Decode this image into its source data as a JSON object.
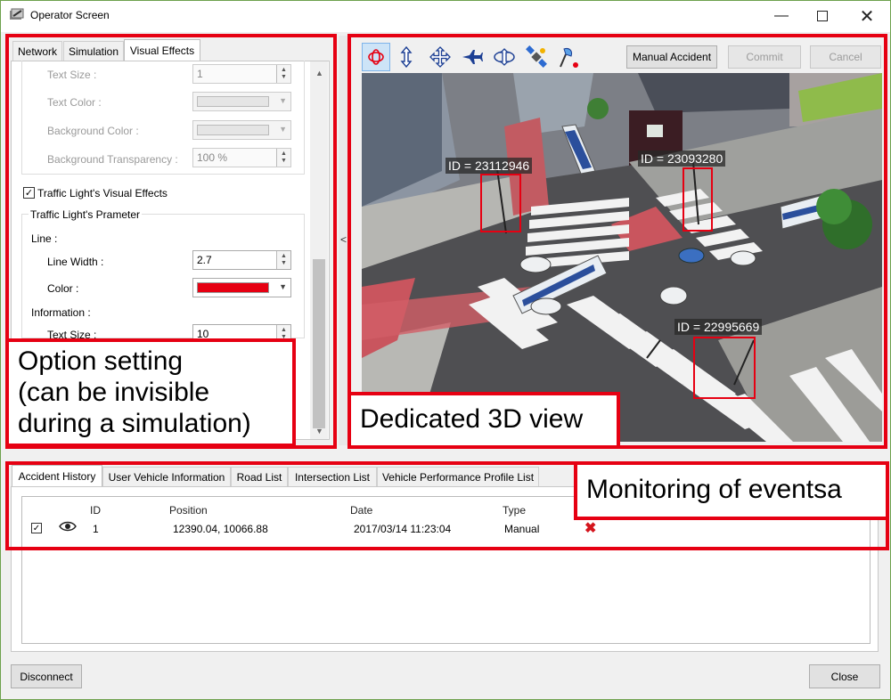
{
  "window": {
    "title": "Operator Screen",
    "minimize_icon": "minimize-icon",
    "maximize_icon": "maximize-icon",
    "close_icon": "close-icon"
  },
  "left_panel": {
    "tabs": [
      {
        "label": "Network"
      },
      {
        "label": "Simulation"
      },
      {
        "label": "Visual Effects",
        "active": true
      }
    ],
    "text_size_label": "Text Size :",
    "text_size_value": "1",
    "text_color_label": "Text Color :",
    "background_color_label": "Background Color :",
    "background_transparency_label": "Background Transparency :",
    "background_transparency_value": "100 %",
    "traffic_lights_checkbox_label": "Traffic Light's Visual Effects",
    "traffic_lights_checked": true,
    "traffic_light_param_title": "Traffic Light's Prameter",
    "line_title": "Line :",
    "line_width_label": "Line Width :",
    "line_width_value": "2.7",
    "color_label": "Color :",
    "line_color": "#e60012",
    "information_title": "Information :",
    "info_text_size_label": "Text Size :",
    "info_text_size_value": "10",
    "splitter_arrow": "<"
  },
  "view3d": {
    "toolbar_icons": [
      "rotate-icon",
      "vertical-move-icon",
      "pan-icon",
      "fly-icon",
      "orbit-icon",
      "satellite-icon",
      "pin-icon"
    ],
    "manual_accident_label": "Manual Accident",
    "commit_label": "Commit",
    "cancel_label": "Cancel",
    "id_labels": [
      "ID = 23112946",
      "ID = 23093280",
      "ID = 22995669"
    ]
  },
  "bottom_panel": {
    "tabs": [
      {
        "label": "Accident History",
        "active": true
      },
      {
        "label": "User Vehicle Information"
      },
      {
        "label": "Road List"
      },
      {
        "label": "Intersection List"
      },
      {
        "label": "Vehicle Performance Profile List"
      }
    ],
    "columns": [
      "ID",
      "Position",
      "Date",
      "Type"
    ],
    "rows": [
      {
        "checked": true,
        "id": "1",
        "position": "12390.04, 10066.88",
        "date": "2017/03/14 11:23:04",
        "type": "Manual"
      }
    ]
  },
  "footer": {
    "disconnect_label": "Disconnect",
    "close_label": "Close"
  },
  "annotations": {
    "option_setting": [
      "Option setting",
      "(can be invisible",
      "during a simulation)"
    ],
    "view3d": "Dedicated 3D view",
    "monitoring": "Monitoring of eventsa",
    "highlight_color": "#e60012"
  }
}
